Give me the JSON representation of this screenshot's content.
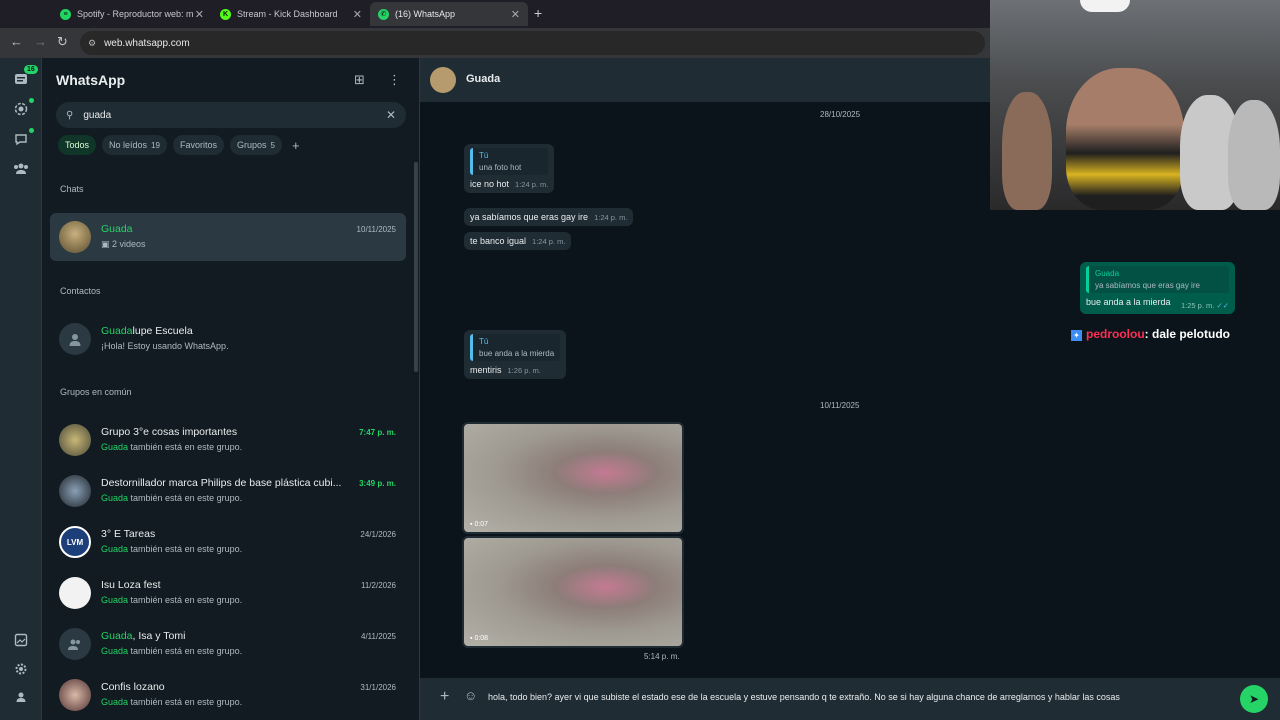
{
  "browser": {
    "tabs": [
      {
        "label": "Spotify - Reproductor web: m",
        "icon": "spotify-icon",
        "color": "#1ed760"
      },
      {
        "label": "Stream - Kick Dashboard",
        "icon": "kick-icon",
        "color": "#53fc18"
      },
      {
        "label": "(16) WhatsApp",
        "icon": "whatsapp-icon",
        "color": "#25d366"
      }
    ],
    "url": "web.whatsapp.com"
  },
  "rail": {
    "badge": "16"
  },
  "sidebar": {
    "title": "WhatsApp",
    "search_value": "guada",
    "filters": [
      {
        "label": "Todos",
        "count": ""
      },
      {
        "label": "No leídos",
        "count": "19"
      },
      {
        "label": "Favoritos",
        "count": ""
      },
      {
        "label": "Grupos",
        "count": "5"
      }
    ],
    "sections": {
      "chats": "Chats",
      "contacts": "Contactos",
      "groups": "Grupos en común"
    },
    "chats": [
      {
        "name": "Guada",
        "sub": "2 videos",
        "time": "10/11/2025"
      }
    ],
    "contacts": [
      {
        "name_highlight": "Guada",
        "name_rest": "lupe Escuela",
        "sub": "¡Hola! Estoy usando WhatsApp."
      }
    ],
    "groups": [
      {
        "name": "Grupo 3°e cosas importantes",
        "sub_highlight": "Guada",
        "sub_rest": " también está en este grupo.",
        "time": "7:47 p. m."
      },
      {
        "name": "Destornillador marca Philips de base plástica cubi...",
        "sub_highlight": "Guada",
        "sub_rest": " también está en este grupo.",
        "time": "3:49 p. m."
      },
      {
        "name": "3° E  Tareas",
        "sub_highlight": "Guada",
        "sub_rest": " también está en este grupo.",
        "time": "24/1/2026"
      },
      {
        "name": "Isu Loza fest",
        "sub_highlight": "Guada",
        "sub_rest": " también está en este grupo.",
        "time": "11/2/2026"
      },
      {
        "name_highlight": "Guada",
        "name": ", Isa y Tomi",
        "sub_highlight": "Guada",
        "sub_rest": " también está en este grupo.",
        "time": "4/11/2025"
      },
      {
        "name": "Confis lozano",
        "sub_highlight": "Guada",
        "sub_rest": " también está en este grupo.",
        "time": "31/1/2026"
      }
    ]
  },
  "chat": {
    "contact": "Guada",
    "date1": "28/10/2025",
    "quote1": {
      "author": "Tú",
      "text": "una foto hot"
    },
    "messages1": [
      {
        "text": "ice no hot",
        "time": "1:24 p. m."
      },
      {
        "text": "ya sabíamos que eras gay ire",
        "time": "1:24 p. m."
      },
      {
        "text": "te banco igual",
        "time": "1:24 p. m."
      }
    ],
    "quote2": {
      "author": "Tú",
      "text": "bue anda a la mierda"
    },
    "message2": {
      "text": "mentiris",
      "time": "1:26 p. m."
    },
    "date2": "10/11/2025",
    "videos": [
      {
        "duration": "0:07"
      },
      {
        "duration": "0:08"
      }
    ],
    "video_time": "5:14 p. m.",
    "composer_text": "hola, todo bien? ayer vi que subiste el estado ese de la escuela y estuve pensando q te extraño. No se si hay alguna chance de arreglarnos y hablar las cosas"
  },
  "overlay": {
    "quote_author": "Guada",
    "quote_text": "ya sabíamos que eras gay ire",
    "text": "bue anda a la mierda",
    "time": "1:25 p. m.",
    "kick_user": "pedroolou",
    "kick_text": ": dale pelotudo"
  },
  "colors": {
    "accent": "#25d366",
    "bg": "#111b21",
    "bubble": "#202c33",
    "outgoing": "#005c4b"
  }
}
